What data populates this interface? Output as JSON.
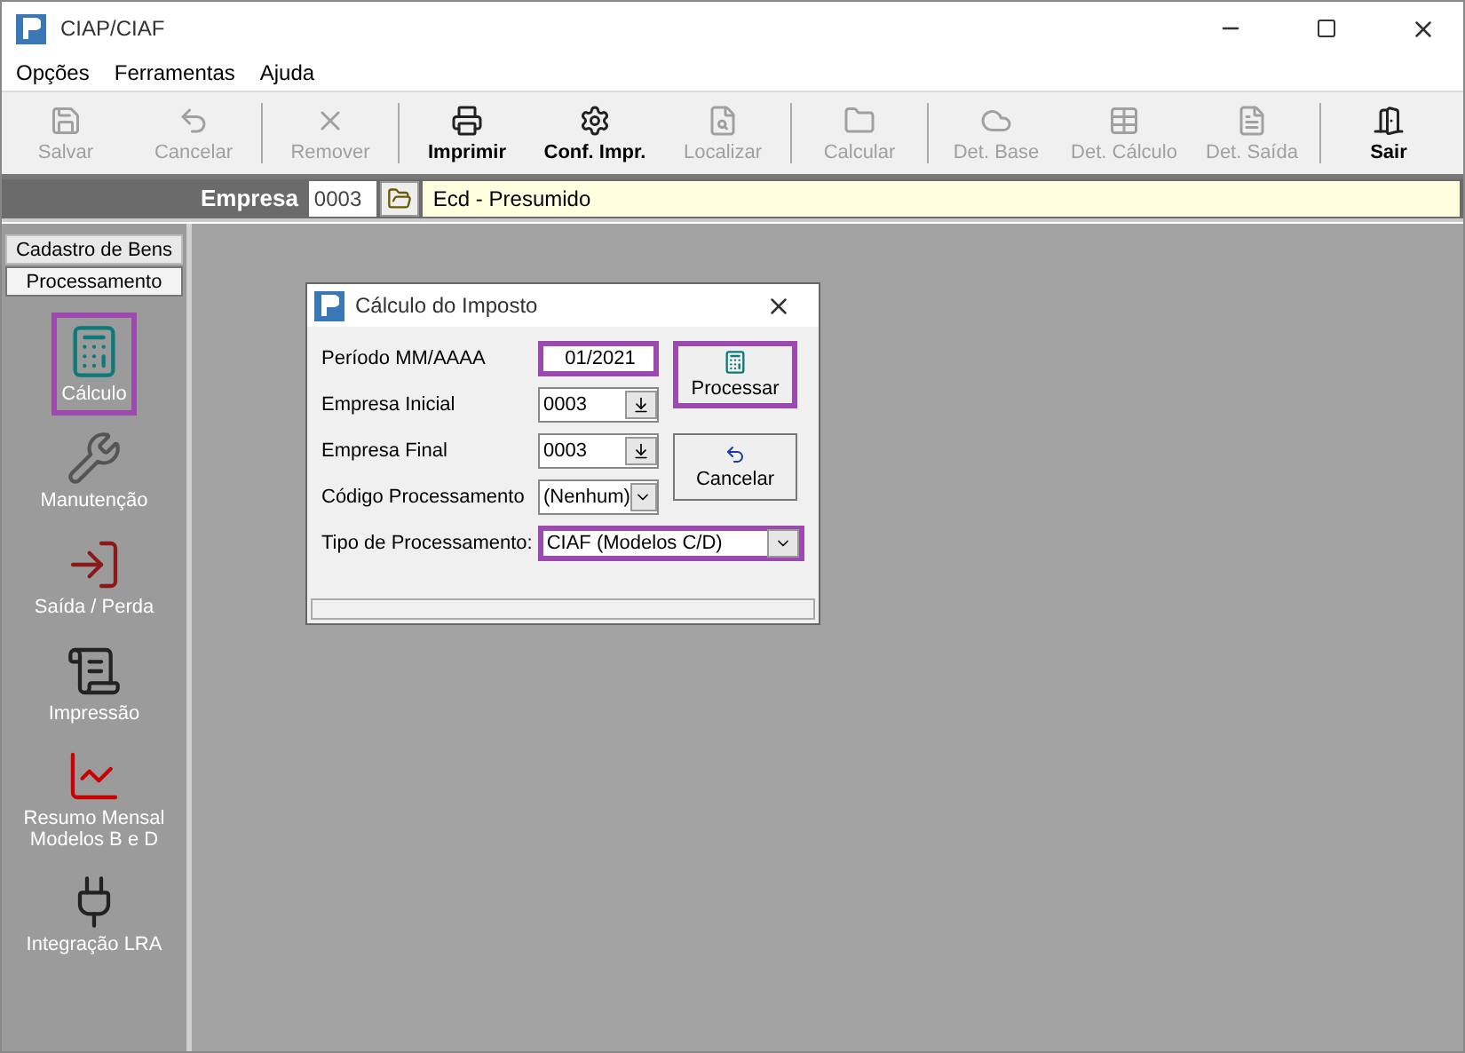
{
  "window": {
    "title": "CIAP/CIAF"
  },
  "menu": [
    "Opções",
    "Ferramentas",
    "Ajuda"
  ],
  "toolbar": [
    {
      "label": "Salvar",
      "kind": "save",
      "disabled": true
    },
    {
      "label": "Cancelar",
      "kind": "undo",
      "disabled": true
    },
    {
      "kind": "separator"
    },
    {
      "label": "Remover",
      "kind": "remove",
      "disabled": true
    },
    {
      "kind": "separator"
    },
    {
      "label": "Imprimir",
      "kind": "print",
      "disabled": false
    },
    {
      "label": "Conf. Impr.",
      "kind": "printsetup",
      "disabled": false
    },
    {
      "label": "Localizar",
      "kind": "find",
      "disabled": true
    },
    {
      "kind": "separator"
    },
    {
      "label": "Calcular",
      "kind": "calc",
      "disabled": true
    },
    {
      "kind": "separator"
    },
    {
      "label": "Det. Base",
      "kind": "base",
      "disabled": true
    },
    {
      "label": "Det. Cálculo",
      "kind": "sheet",
      "disabled": true
    },
    {
      "label": "Det. Saída",
      "kind": "exit-detail",
      "disabled": true
    },
    {
      "kind": "separator"
    },
    {
      "label": "Sair",
      "kind": "door",
      "disabled": false
    }
  ],
  "company_bar": {
    "label": "Empresa",
    "code": "0003",
    "name": "Ecd - Presumido"
  },
  "sidebar": {
    "sections": [
      {
        "label": "Cadastro de Bens",
        "selected": false
      },
      {
        "label": "Processamento",
        "selected": true
      }
    ],
    "items": [
      {
        "label": "Cálculo",
        "kind": "calculator",
        "highlighted": true
      },
      {
        "label": "Manutenção",
        "kind": "wrench",
        "highlighted": false
      },
      {
        "label": "Saída / Perda",
        "kind": "door",
        "highlighted": false
      },
      {
        "label": "Impressão",
        "kind": "printer",
        "highlighted": false
      },
      {
        "label": "Resumo Mensal Modelos B e D",
        "kind": "chart",
        "highlighted": false
      },
      {
        "label": "Integração LRA",
        "kind": "plug",
        "highlighted": false
      }
    ]
  },
  "dialog": {
    "title": "Cálculo do Imposto",
    "fields": [
      {
        "label": "Período  MM/AAAA",
        "value": "01/2021",
        "kind": "text",
        "highlighted": true
      },
      {
        "label": "Empresa Inicial",
        "value": "0003",
        "kind": "lookup",
        "highlighted": false
      },
      {
        "label": "Empresa Final",
        "value": "0003",
        "kind": "lookup",
        "highlighted": false
      },
      {
        "label": "Código Processamento",
        "value": "(Nenhum)",
        "kind": "combo",
        "highlighted": false
      },
      {
        "label": "Tipo de Processamento:",
        "value": "CIAF (Modelos C/D)",
        "kind": "wide-combo",
        "highlighted": true
      }
    ],
    "buttons": [
      {
        "label": "Processar",
        "kind": "process",
        "highlighted": true
      },
      {
        "label": "Cancelar",
        "kind": "cancel",
        "highlighted": false
      }
    ]
  }
}
